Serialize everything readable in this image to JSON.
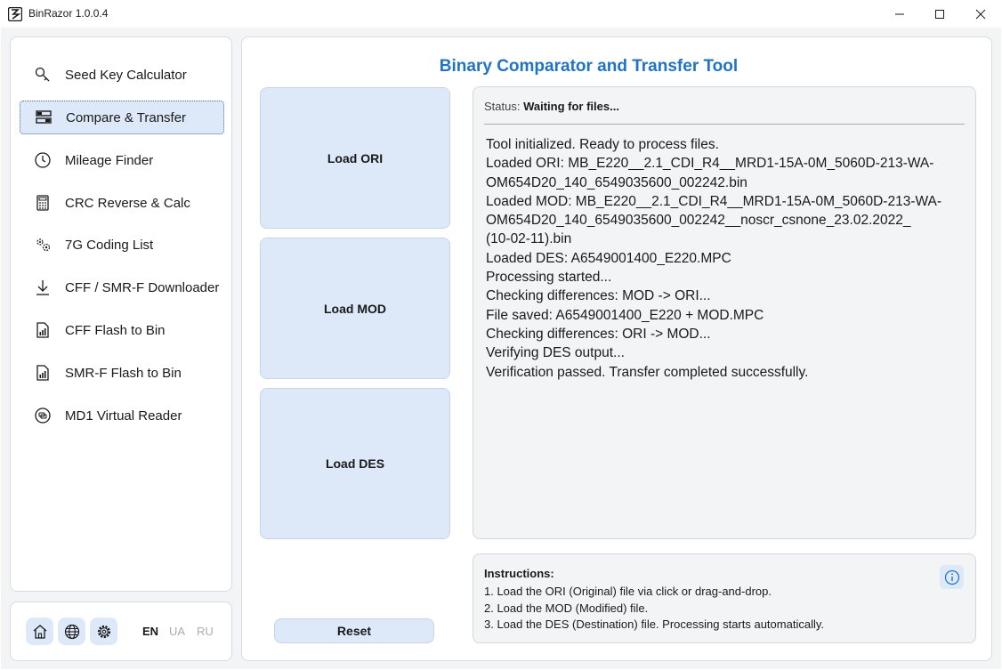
{
  "window": {
    "title": "BinRazor 1.0.0.4"
  },
  "sidebar": {
    "items": [
      {
        "label": "Seed Key Calculator",
        "icon": "key-icon"
      },
      {
        "label": "Compare & Transfer",
        "icon": "compare-icon",
        "active": true
      },
      {
        "label": "Mileage Finder",
        "icon": "clock-icon"
      },
      {
        "label": "CRC Reverse & Calc",
        "icon": "calculator-icon"
      },
      {
        "label": "7G Coding List",
        "icon": "gears-icon"
      },
      {
        "label": "CFF / SMR-F Downloader",
        "icon": "download-icon"
      },
      {
        "label": "CFF Flash to Bin",
        "icon": "file-chart-icon"
      },
      {
        "label": "SMR-F Flash to Bin",
        "icon": "file-chart-icon"
      },
      {
        "label": "MD1 Virtual Reader",
        "icon": "reader-icon"
      }
    ],
    "footer": {
      "buttons": [
        "home-icon",
        "globe-icon",
        "settings-icon"
      ],
      "languages": [
        {
          "code": "EN",
          "active": true
        },
        {
          "code": "UA",
          "active": false
        },
        {
          "code": "RU",
          "active": false
        }
      ]
    }
  },
  "main": {
    "title": "Binary Comparator and Transfer Tool",
    "load_ori": "Load ORI",
    "load_mod": "Load MOD",
    "load_des": "Load DES",
    "reset": "Reset",
    "status_label": "Status:",
    "status_value": "Waiting for files...",
    "log": [
      "Tool initialized. Ready to process files.",
      "Loaded ORI: MB_E220__2.1_CDI_R4__MRD1-15A-0M_5060D-213-WA-",
      "OM654D20_140_6549035600_002242.bin",
      "Loaded MOD: MB_E220__2.1_CDI_R4__MRD1-15A-0M_5060D-213-WA-",
      "OM654D20_140_6549035600_002242__noscr_csnone_23.02.2022_",
      "(10-02-11).bin",
      "Loaded DES: A6549001400_E220.MPC",
      "Processing started...",
      "Checking differences: MOD -> ORI...",
      "File saved: A6549001400_E220 + MOD.MPC",
      "Checking differences: ORI -> MOD...",
      "Verifying DES output...",
      "Verification passed. Transfer completed successfully."
    ],
    "instructions": {
      "title": "Instructions:",
      "steps": [
        "1. Load the ORI (Original) file via click or drag-and-drop.",
        "2. Load the MOD (Modified) file.",
        "3. Load the DES (Destination) file. Processing starts automatically."
      ]
    }
  },
  "colors": {
    "accent": "#1f73c5",
    "button_bg": "#dde8f8",
    "panel_bg": "#f3f4f6"
  }
}
